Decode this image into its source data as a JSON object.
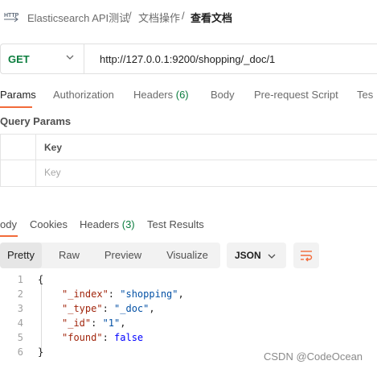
{
  "breadcrumb": {
    "icon": "http-icon",
    "items": [
      "Elasticsearch API测试",
      "文档操作"
    ],
    "separator": "/",
    "current": "查看文档"
  },
  "request": {
    "method": "GET",
    "url": "http://127.0.0.1:9200/shopping/_doc/1"
  },
  "request_tabs": [
    {
      "label": "Params",
      "active": true
    },
    {
      "label": "Authorization"
    },
    {
      "label": "Headers ",
      "count": "(6)"
    },
    {
      "label": "Body"
    },
    {
      "label": "Pre-request Script"
    },
    {
      "label": "Tes"
    }
  ],
  "query_params": {
    "title": "Query Params",
    "header_key": "Key",
    "placeholder_key": "Key"
  },
  "response_tabs": [
    {
      "label": "ody",
      "active": true
    },
    {
      "label": "Cookies"
    },
    {
      "label": "Headers ",
      "count": "(3)"
    },
    {
      "label": "Test Results"
    }
  ],
  "response_toolbar": {
    "modes": [
      "Pretty",
      "Raw",
      "Preview",
      "Visualize"
    ],
    "active_mode": "Pretty",
    "format": "JSON"
  },
  "response_body": {
    "line_numbers": [
      "1",
      "2",
      "3",
      "4",
      "5",
      "6"
    ],
    "open_brace": "{",
    "close_brace": "}",
    "fields": [
      {
        "key": "\"_index\"",
        "value": "\"shopping\"",
        "type": "string",
        "comma": ","
      },
      {
        "key": "\"_type\"",
        "value": "\"_doc\"",
        "type": "string",
        "comma": ","
      },
      {
        "key": "\"_id\"",
        "value": "\"1\"",
        "type": "string",
        "comma": ","
      },
      {
        "key": "\"found\"",
        "value": "false",
        "type": "bool",
        "comma": ""
      }
    ]
  },
  "watermark": "CSDN @CodeOcean",
  "colors": {
    "accent": "#f26b3a",
    "method_get": "#0b7d3e",
    "json_key": "#a1260d",
    "json_string": "#0451a5",
    "json_bool": "#0000ff"
  }
}
